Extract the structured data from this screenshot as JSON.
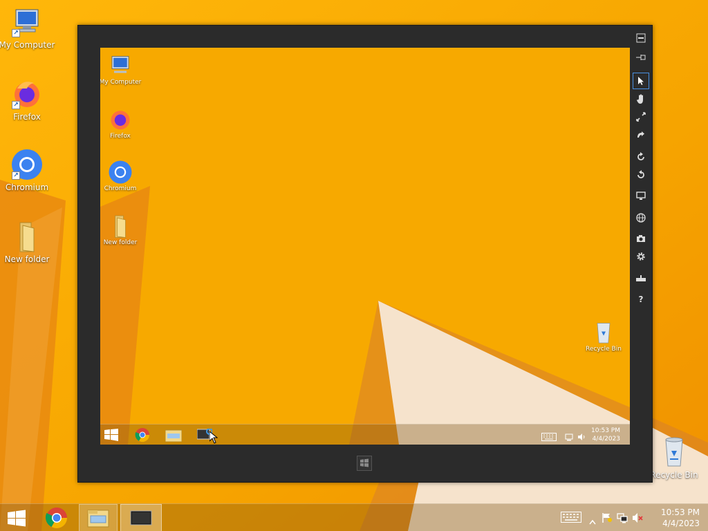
{
  "desktop": {
    "icons": [
      {
        "label": "My Computer",
        "icon": "my-computer-icon"
      },
      {
        "label": "Firefox",
        "icon": "firefox-icon"
      },
      {
        "label": "Chromium",
        "icon": "chromium-icon"
      },
      {
        "label": "New folder",
        "icon": "folder-icon"
      },
      {
        "label": "Recycle Bin",
        "icon": "recycle-bin-icon"
      }
    ]
  },
  "taskbar": {
    "items": [
      {
        "icon": "windows-start-icon"
      },
      {
        "icon": "chrome-icon"
      },
      {
        "icon": "file-explorer-icon"
      },
      {
        "icon": "remote-viewer-icon"
      }
    ],
    "tray": {
      "keyboard": "keyboard-icon",
      "chevron": "show-hidden-icons-icon",
      "flag": "action-center-flag-icon",
      "network": "network-icon",
      "volume": "volume-muted-icon"
    },
    "clock": {
      "time": "10:53 PM",
      "date": "4/4/2023"
    }
  },
  "viewer": {
    "toolbar": [
      {
        "icon": "minimize-icon"
      },
      {
        "icon": "pin-icon"
      },
      {
        "icon": "pointer-icon"
      },
      {
        "icon": "hand-icon"
      },
      {
        "icon": "scale-icon"
      },
      {
        "icon": "curve-arrow-icon"
      },
      {
        "icon": "refresh-icon"
      },
      {
        "icon": "rotate-icon"
      },
      {
        "icon": "monitor-icon"
      },
      {
        "icon": "globe-icon"
      },
      {
        "icon": "camera-icon"
      },
      {
        "icon": "settings-gear-icon"
      },
      {
        "icon": "keyboard-toggle-icon"
      },
      {
        "icon": "help-icon"
      }
    ],
    "active_tool": "pointer-icon",
    "remote": {
      "icons": [
        {
          "label": "My Computer",
          "icon": "my-computer-icon"
        },
        {
          "label": "Firefox",
          "icon": "firefox-icon"
        },
        {
          "label": "Chromium",
          "icon": "chromium-icon"
        },
        {
          "label": "New folder",
          "icon": "folder-icon"
        },
        {
          "label": "Recycle Bin",
          "icon": "recycle-bin-icon"
        }
      ],
      "clock": {
        "time": "10:53 PM",
        "date": "4/4/2023"
      }
    }
  },
  "colors": {
    "wallpaper_orange": "#f6a800",
    "wallpaper_deep": "#e8830c",
    "wallpaper_light": "#f8e7d1",
    "viewer_frame": "#2b2b2b",
    "accent_blue": "#4a90e2"
  }
}
